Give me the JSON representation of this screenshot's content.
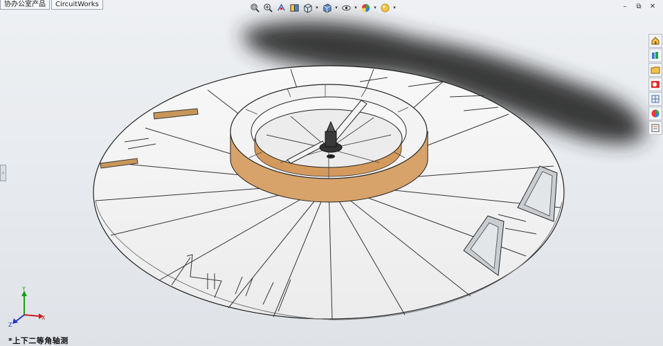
{
  "tabs": [
    {
      "label": "协办公室产品"
    },
    {
      "label": "CircuitWorks"
    }
  ],
  "view_toolbar": [
    {
      "icon": "zoom-to-fit-icon"
    },
    {
      "icon": "zoom-to-area-icon"
    },
    {
      "icon": "previous-view-icon"
    },
    {
      "icon": "section-view-icon"
    },
    {
      "icon": "view-orientation-icon"
    },
    {
      "icon": "display-style-icon"
    },
    {
      "icon": "hide-show-items-icon"
    },
    {
      "icon": "edit-appearance-icon"
    },
    {
      "icon": "apply-scene-icon"
    }
  ],
  "window_controls": [
    "–",
    "⧉",
    "✕"
  ],
  "task_pane": [
    {
      "icon": "home-icon"
    },
    {
      "icon": "design-library-icon"
    },
    {
      "icon": "file-explorer-icon"
    },
    {
      "icon": "search-icon"
    },
    {
      "icon": "view-palette-icon"
    },
    {
      "icon": "appearances-icon"
    },
    {
      "icon": "custom-properties-icon"
    }
  ],
  "triad": {
    "x_label": "X",
    "y_label": "Y",
    "z_label": "Z"
  },
  "view_name": "*上下二等角轴测",
  "colors": {
    "background": "#e8ebef",
    "disc": "#f4f4f4",
    "wood": "#d7a36a",
    "edges": "#1e1e1e",
    "shadow": "#2a2a2a"
  }
}
